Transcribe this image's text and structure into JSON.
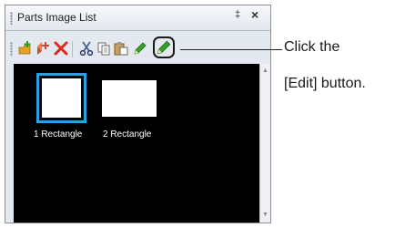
{
  "panel": {
    "title": "Parts Image List",
    "pin_glyph": "‡",
    "close_glyph": "×"
  },
  "toolbar": {
    "buttons": [
      {
        "icon": "add-folder-icon"
      },
      {
        "icon": "add-parts-icon"
      },
      {
        "icon": "delete-icon"
      },
      {
        "icon": "cut-icon"
      },
      {
        "icon": "copy-icon"
      },
      {
        "icon": "paste-icon"
      },
      {
        "icon": "edit-icon"
      },
      {
        "icon": "display-icon"
      }
    ]
  },
  "images": [
    {
      "label": "1 Rectangle",
      "selected": true
    },
    {
      "label": "2 Rectangle",
      "selected": false
    }
  ],
  "callout": {
    "line1": "Click the",
    "line2": "[Edit] button."
  },
  "colors": {
    "selection": "#2aa0e0",
    "canvas_bg": "#000000",
    "panel_bg": "#e4e8ef",
    "delete": "#e0261f",
    "edit_green": "#37a12b",
    "display_blue": "#1d6fd0"
  }
}
